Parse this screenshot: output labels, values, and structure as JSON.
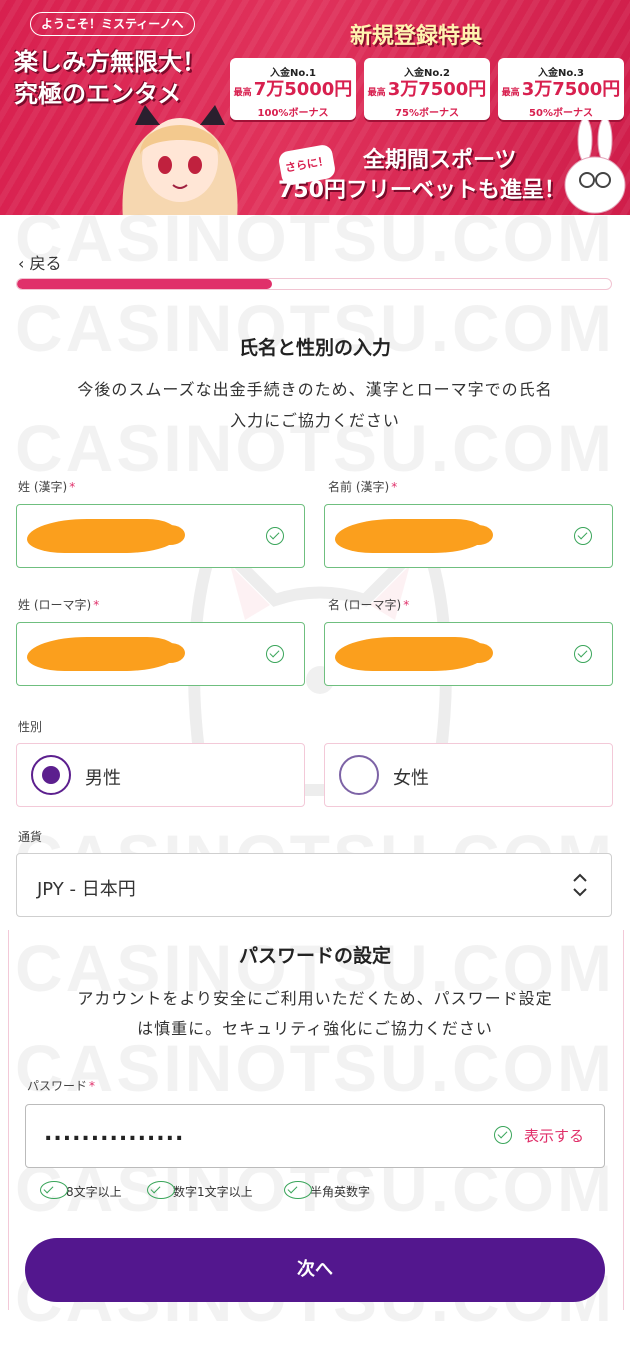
{
  "banner": {
    "welcome": "ようこそ！ミスティーノへ",
    "tagline_line1": "楽しみ方無限大！",
    "tagline_line2": "究極のエンタメ",
    "bonus_title": "新規登録特典",
    "cards": [
      {
        "label": "入金No.1",
        "prefix": "最高",
        "amount": "7万5000円",
        "percent": "100%ボーナス"
      },
      {
        "label": "入金No.2",
        "prefix": "最高",
        "amount": "3万7500円",
        "percent": "75%ボーナス"
      },
      {
        "label": "入金No.3",
        "prefix": "最高",
        "amount": "3万7500円",
        "percent": "50%ボーナス"
      }
    ],
    "sarani": "さらに！",
    "promo_line1": "全期間スポーツ",
    "promo_line2": "750円フリーベットも進呈！"
  },
  "nav": {
    "back_label": "戻る"
  },
  "progress": {
    "value": 0.43
  },
  "name_section": {
    "title": "氏名と性別の入力",
    "description_line1": "今後のスムーズな出金手続きのため、漢字とローマ字での氏名",
    "description_line2": "入力にご協力ください",
    "last_name_kanji_label": "姓 (漢字)",
    "first_name_kanji_label": "名前 (漢字)",
    "last_name_roman_label": "姓 (ローマ字)",
    "first_name_roman_label": "名 (ローマ字)",
    "required_mark": "*"
  },
  "gender": {
    "label": "性別",
    "male": "男性",
    "female": "女性",
    "selected": "男性"
  },
  "currency": {
    "label": "通貨",
    "value": "JPY - 日本円"
  },
  "password_section": {
    "title": "パスワードの設定",
    "description_line1": "アカウントをより安全にご利用いただくため、パスワード設定",
    "description_line2": "は慎重に。セキュリティ強化にご協力ください",
    "label": "パスワード",
    "required_mark": "*",
    "masked_value": "...............",
    "show_label": "表示する",
    "rules": [
      "8文字以上",
      "数字1文字以上",
      "半角英数字"
    ]
  },
  "next_button": "次へ",
  "watermark": "CASINOTSU.COM",
  "colors": {
    "brand_pink": "#e0306a",
    "brand_purple": "#53178e",
    "valid_green": "#3aa55a",
    "banner_red": "#d8204f"
  }
}
